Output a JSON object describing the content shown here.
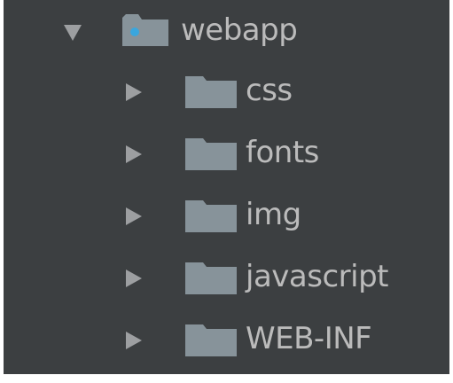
{
  "tree": {
    "root": {
      "label": "webapp",
      "expanded": true,
      "icon": "web-folder-icon",
      "children": [
        {
          "label": "css",
          "expanded": false,
          "icon": "folder-icon"
        },
        {
          "label": "fonts",
          "expanded": false,
          "icon": "folder-icon"
        },
        {
          "label": "img",
          "expanded": false,
          "icon": "folder-icon"
        },
        {
          "label": "javascript",
          "expanded": false,
          "icon": "folder-icon"
        },
        {
          "label": "WEB-INF",
          "expanded": false,
          "icon": "folder-icon"
        }
      ]
    },
    "colors": {
      "background": "#3c3f41",
      "text": "#bbbbbb",
      "arrow": "#9d9fa1",
      "folder": "#87939a",
      "folder_tab": "#9aa5ab",
      "web_dot": "#3aa6dd"
    }
  }
}
